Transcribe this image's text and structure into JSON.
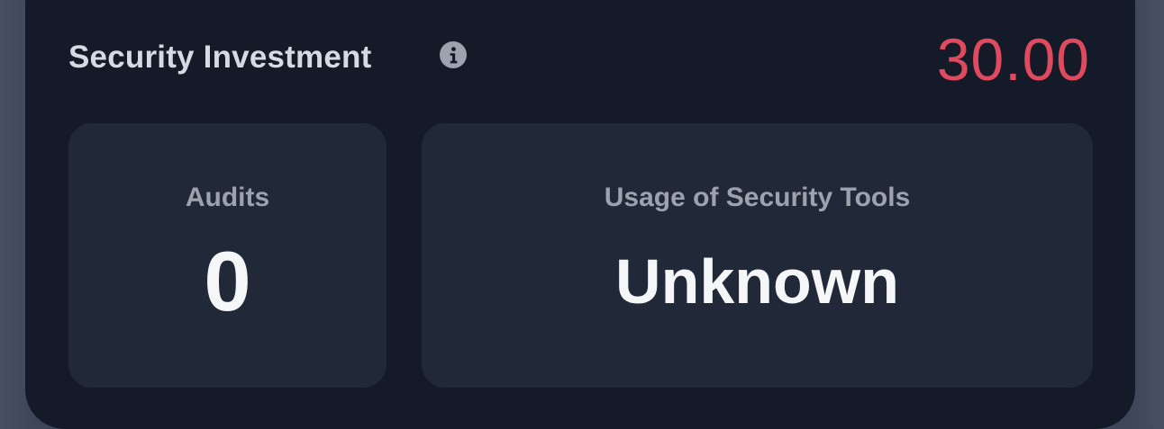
{
  "card": {
    "title": "Security Investment",
    "info_icon": "info-icon",
    "score": "30.00",
    "score_color": "#e04a5f"
  },
  "tiles": [
    {
      "label": "Audits",
      "value": "0"
    },
    {
      "label": "Usage of Security Tools",
      "value": "Unknown"
    }
  ]
}
